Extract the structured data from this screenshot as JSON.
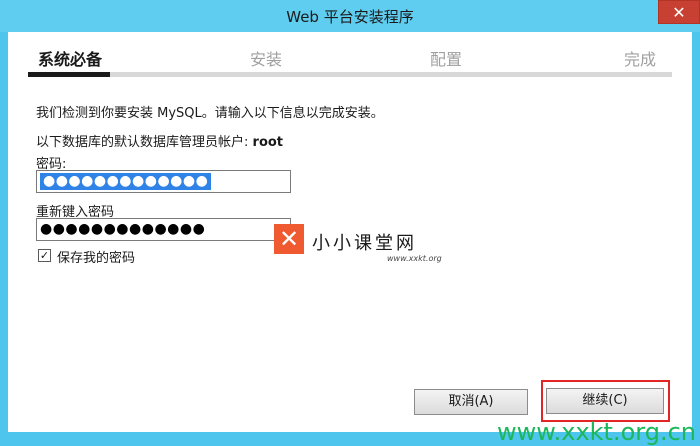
{
  "window": {
    "title": "Web 平台安装程序",
    "close_glyph": "✕"
  },
  "steps": [
    {
      "label": "系统必备",
      "active": true
    },
    {
      "label": "安装",
      "active": false
    },
    {
      "label": "配置",
      "active": false
    },
    {
      "label": "完成",
      "active": false
    }
  ],
  "content": {
    "intro": "我们检测到你要安装 MySQL。请输入以下信息以完成安装。",
    "admin_label": "以下数据库的默认数据库管理员帐户:",
    "admin_user": "root",
    "password_label": "密码:",
    "password_value": "●●●●●●●●●●●●●",
    "confirm_label": "重新键入密码",
    "confirm_value": "●●●●●●●●●●●●●",
    "save_password_label": "保存我的密码",
    "save_password_checked": "✓"
  },
  "watermark": {
    "logo_glyph": "✕",
    "cn_text": "小小课堂网",
    "site_text": "www.xxkt.org",
    "footer_text": "www.xxkt.org.cn"
  },
  "buttons": {
    "cancel": "取消(A)",
    "continue": "继续(C)"
  },
  "colors": {
    "titlebar": "#5fcdf0",
    "close": "#c84031",
    "selection": "#2f82e6",
    "highlight": "#e22626",
    "logo": "#ef5a31",
    "footer_watermark": "#1bb85a"
  }
}
